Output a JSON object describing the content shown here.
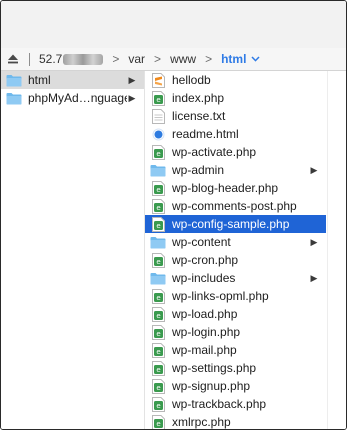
{
  "path": {
    "host": "52.7",
    "segments": [
      "var",
      "www"
    ],
    "current": "html"
  },
  "column1": [
    {
      "label": "html",
      "icon": "folder-icon",
      "selected": true,
      "has_children": true
    },
    {
      "label": "phpMyAd…nguages",
      "icon": "folder-icon",
      "selected": false,
      "has_children": true
    }
  ],
  "column2": [
    {
      "label": "hellodb",
      "icon": "sublime-file-icon",
      "selected": false,
      "has_children": false
    },
    {
      "label": "index.php",
      "icon": "php-file-icon",
      "selected": false,
      "has_children": false
    },
    {
      "label": "license.txt",
      "icon": "text-file-icon",
      "selected": false,
      "has_children": false
    },
    {
      "label": "readme.html",
      "icon": "html-file-icon",
      "selected": false,
      "has_children": false
    },
    {
      "label": "wp-activate.php",
      "icon": "php-file-icon",
      "selected": false,
      "has_children": false
    },
    {
      "label": "wp-admin",
      "icon": "folder-icon",
      "selected": false,
      "has_children": true
    },
    {
      "label": "wp-blog-header.php",
      "icon": "php-file-icon",
      "selected": false,
      "has_children": false
    },
    {
      "label": "wp-comments-post.php",
      "icon": "php-file-icon",
      "selected": false,
      "has_children": false
    },
    {
      "label": "wp-config-sample.php",
      "icon": "php-file-icon",
      "selected": true,
      "has_children": false
    },
    {
      "label": "wp-content",
      "icon": "folder-icon",
      "selected": false,
      "has_children": true
    },
    {
      "label": "wp-cron.php",
      "icon": "php-file-icon",
      "selected": false,
      "has_children": false
    },
    {
      "label": "wp-includes",
      "icon": "folder-icon",
      "selected": false,
      "has_children": true
    },
    {
      "label": "wp-links-opml.php",
      "icon": "php-file-icon",
      "selected": false,
      "has_children": false
    },
    {
      "label": "wp-load.php",
      "icon": "php-file-icon",
      "selected": false,
      "has_children": false
    },
    {
      "label": "wp-login.php",
      "icon": "php-file-icon",
      "selected": false,
      "has_children": false
    },
    {
      "label": "wp-mail.php",
      "icon": "php-file-icon",
      "selected": false,
      "has_children": false
    },
    {
      "label": "wp-settings.php",
      "icon": "php-file-icon",
      "selected": false,
      "has_children": false
    },
    {
      "label": "wp-signup.php",
      "icon": "php-file-icon",
      "selected": false,
      "has_children": false
    },
    {
      "label": "wp-trackback.php",
      "icon": "php-file-icon",
      "selected": false,
      "has_children": false
    },
    {
      "label": "xmlrpc.php",
      "icon": "php-file-icon",
      "selected": false,
      "has_children": false
    }
  ],
  "colors": {
    "selection": "#1f64d6",
    "selection_inactive": "#dcdcdc",
    "folder": "#6fb9ec",
    "php_icon": "#3a9a4e",
    "current_crumb": "#2f7be6"
  }
}
